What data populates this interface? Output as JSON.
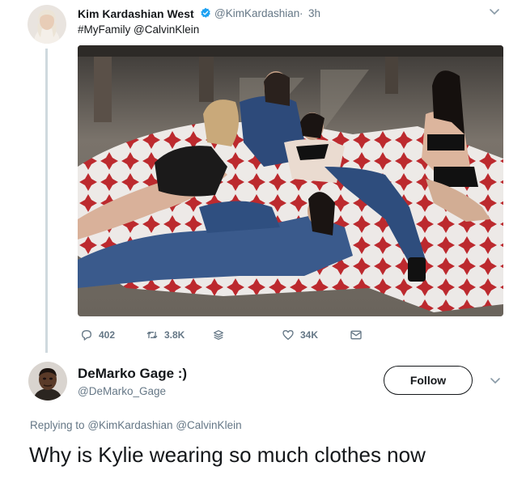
{
  "tweet": {
    "author_name": "Kim Kardashian West",
    "verified_icon": "verified-badge-icon",
    "handle": "@KimKardashian",
    "separator": "·",
    "time": "3h",
    "text": "#MyFamily @CalvinKlein",
    "avatar_icon": "user-avatar",
    "more_icon": "chevron-down-icon",
    "actions": {
      "reply_count": "402",
      "retweet_count": "3.8K",
      "like_count": "34K"
    }
  },
  "reply": {
    "author_name": "DeMarko Gage :)",
    "handle": "@DeMarko_Gage",
    "follow_label": "Follow",
    "replying_prefix": "Replying to",
    "replying_to_1": "@KimKardashian",
    "replying_to_2": "@CalvinKlein",
    "text": "Why is Kylie wearing so much clothes now"
  },
  "colors": {
    "text": "#14171a",
    "secondary": "#657786",
    "verified": "#1da1f2",
    "thread_line": "#cfd9de"
  }
}
